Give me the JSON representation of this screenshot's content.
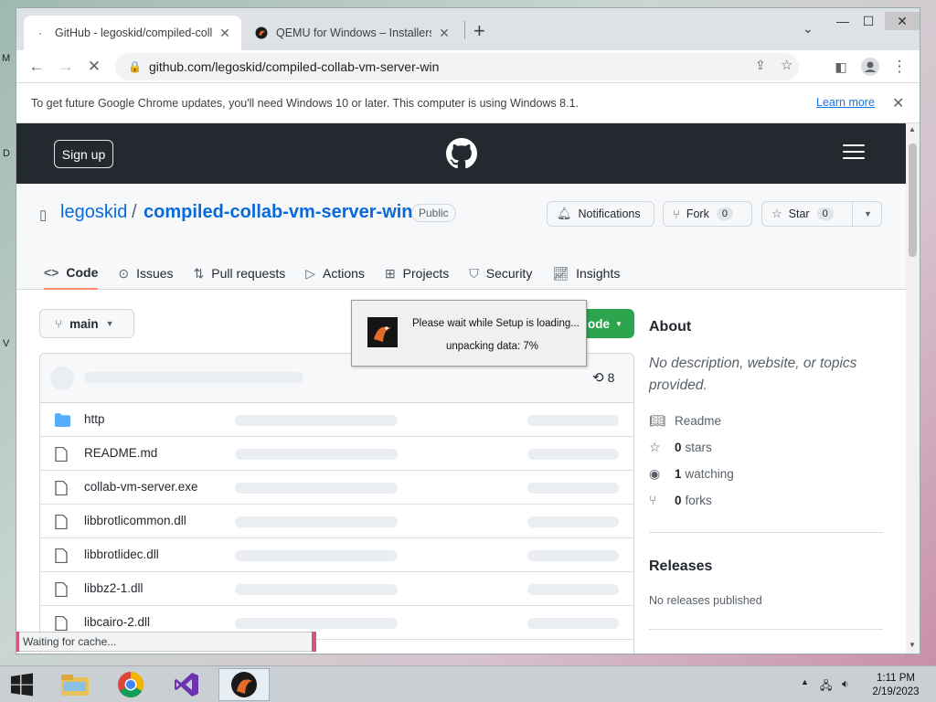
{
  "browser": {
    "tabs": [
      {
        "title": "GitHub - legoskid/compiled-colla",
        "active": true
      },
      {
        "title": "QEMU for Windows – Installers (",
        "active": false
      }
    ],
    "new_tab": "+",
    "tab_search": "⌄",
    "window_controls": {
      "minimize": "—",
      "maximize": "☐",
      "close": "✕"
    },
    "url": "github.com/legoskid/compiled-collab-vm-server-win",
    "infobar": {
      "message": "To get future Google Chrome updates, you'll need Windows 10 or later. This computer is using Windows 8.1.",
      "link": "Learn more",
      "close": "✕"
    },
    "status_text": "Waiting for cache..."
  },
  "github": {
    "header": {
      "signup": "Sign up"
    },
    "repo": {
      "owner": "legoskid",
      "separator": "/",
      "name": "compiled-collab-vm-server-win",
      "visibility": "Public",
      "notifications": "Notifications",
      "fork_label": "Fork",
      "fork_count": "0",
      "star_label": "Star",
      "star_count": "0"
    },
    "tabs": [
      {
        "label": "Code",
        "icon": "code-icon",
        "selected": true
      },
      {
        "label": "Issues",
        "icon": "issue-icon"
      },
      {
        "label": "Pull requests",
        "icon": "pull-request-icon"
      },
      {
        "label": "Actions",
        "icon": "play-icon"
      },
      {
        "label": "Projects",
        "icon": "table-icon"
      },
      {
        "label": "Security",
        "icon": "shield-icon"
      },
      {
        "label": "Insights",
        "icon": "graph-icon"
      }
    ],
    "branch": "main",
    "code_button": "ode",
    "commit_count": "8",
    "files": [
      {
        "name": "http",
        "type": "folder"
      },
      {
        "name": "README.md",
        "type": "file"
      },
      {
        "name": "collab-vm-server.exe",
        "type": "file"
      },
      {
        "name": "libbrotlicommon.dll",
        "type": "file"
      },
      {
        "name": "libbrotlidec.dll",
        "type": "file"
      },
      {
        "name": "libbz2-1.dll",
        "type": "file"
      },
      {
        "name": "libcairo-2.dll",
        "type": "file"
      }
    ],
    "about": {
      "heading": "About",
      "description": "No description, website, or topics provided.",
      "readme": "Readme",
      "stars_count": "0",
      "stars_label": "stars",
      "watching_count": "1",
      "watching_label": "watching",
      "forks_count": "0",
      "forks_label": "forks"
    },
    "releases": {
      "heading": "Releases",
      "text": "No releases published"
    }
  },
  "setup_dialog": {
    "line1": "Please wait while Setup is loading...",
    "line2": "unpacking data: 7%",
    "progress_percent": 7
  },
  "taskbar": {
    "time": "1:11 PM",
    "date": "2/19/2023",
    "apps": [
      "start-icon",
      "file-explorer-icon",
      "chrome-icon",
      "visual-studio-icon",
      "qemu-icon"
    ]
  },
  "colors": {
    "github_header": "#24292f",
    "link_blue": "#0969da",
    "code_green": "#2da44e",
    "tab_underline": "#fd8c73"
  }
}
